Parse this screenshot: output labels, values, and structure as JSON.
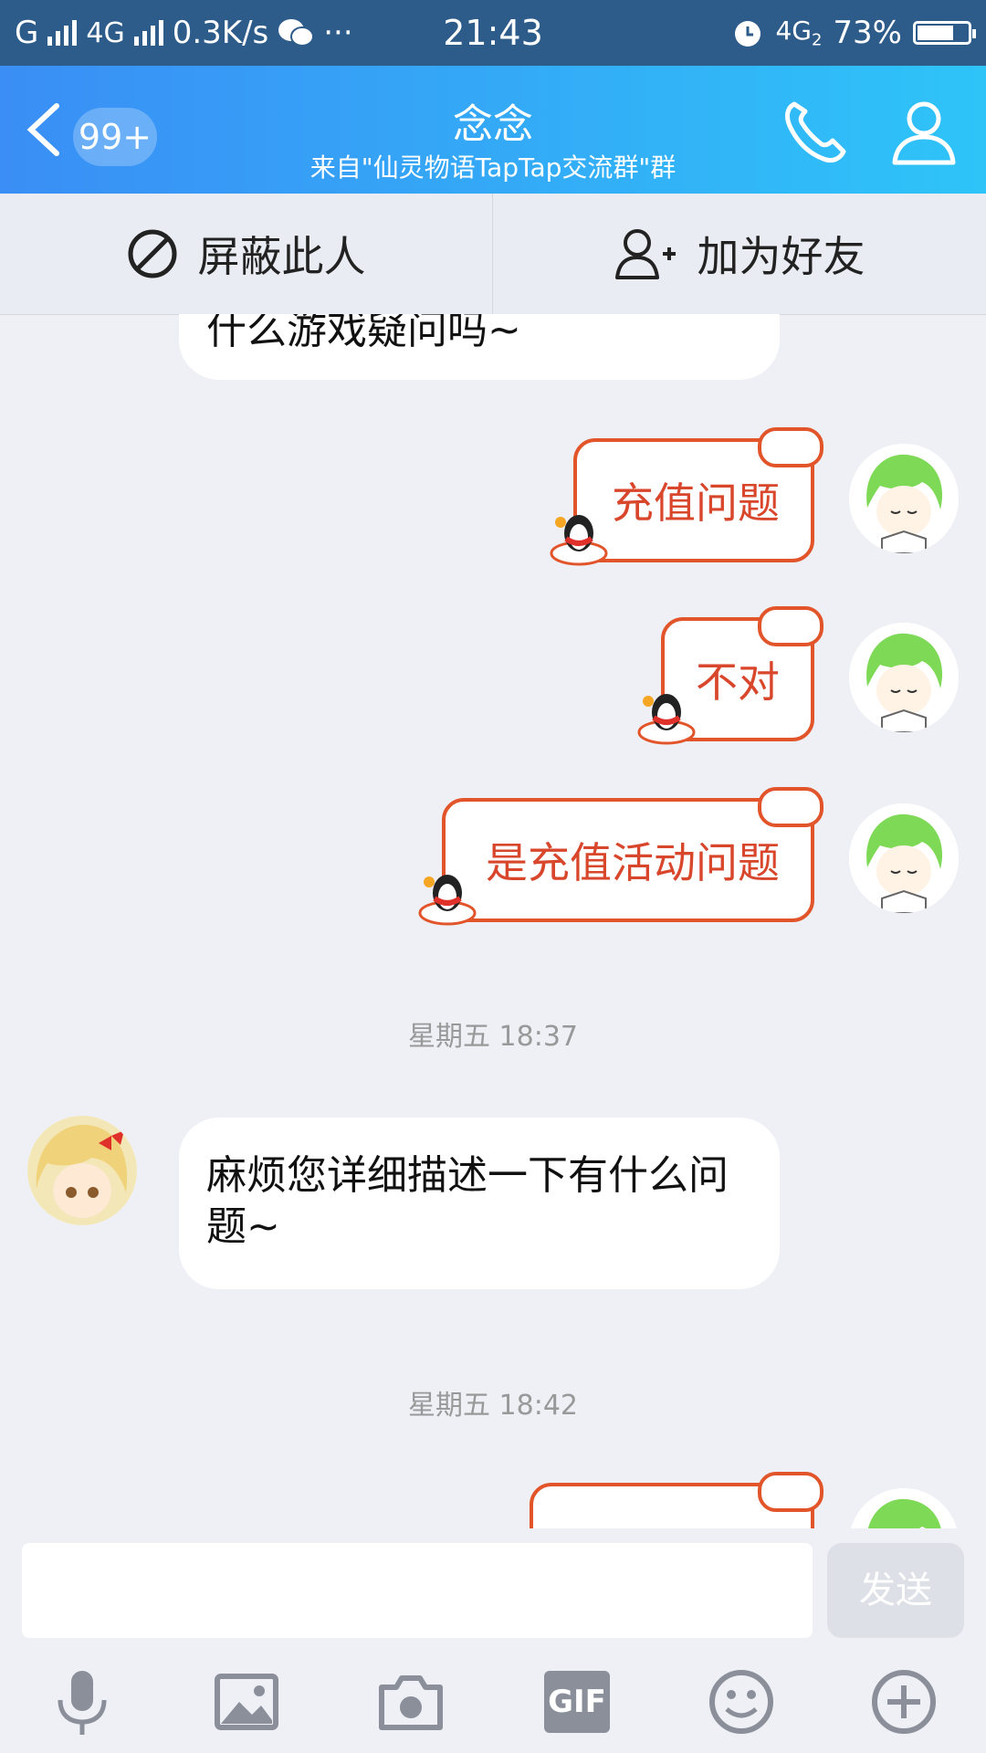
{
  "status_bar": {
    "carrier_1": "G",
    "carrier_2": "4G",
    "speed": "0.3K/s",
    "more": "···",
    "time": "21:43",
    "network": "4G",
    "sim_slot": "2",
    "battery_percent_text": "73%",
    "battery_level": 0.73
  },
  "header": {
    "unread_count": "99+",
    "title": "念念",
    "subtitle": "来自\"仙灵物语TapTap交流群\"群"
  },
  "actions": {
    "block_label": "屏蔽此人",
    "add_friend_label": "加为好友"
  },
  "messages": [
    {
      "type": "incoming_partial",
      "text": "什么游戏疑问吗~"
    },
    {
      "type": "sticker_out",
      "text": "充值问题"
    },
    {
      "type": "sticker_out",
      "text": "不对"
    },
    {
      "type": "sticker_out",
      "text": "是充值活动问题"
    },
    {
      "type": "timestamp",
      "text": "星期五 18:37"
    },
    {
      "type": "incoming",
      "text": "麻烦您详细描述一下有什么问题~"
    },
    {
      "type": "timestamp",
      "text": "星期五 18:42"
    },
    {
      "type": "sticker_out_partial",
      "text": ""
    }
  ],
  "input": {
    "value": "",
    "send_label": "发送"
  },
  "toolbar": {
    "gif_label": "GIF"
  },
  "colors": {
    "header_start": "#3a8ef5",
    "header_end": "#2ec4f8",
    "statusbar": "#2d5c8a",
    "sticker_border": "#e2552b",
    "sticker_text": "#d8462b"
  },
  "icons": [
    "back-icon",
    "phone-icon",
    "profile-icon",
    "block-icon",
    "add-friend-icon",
    "microphone-icon",
    "image-icon",
    "camera-icon",
    "gif-icon",
    "emoji-icon",
    "plus-icon"
  ]
}
